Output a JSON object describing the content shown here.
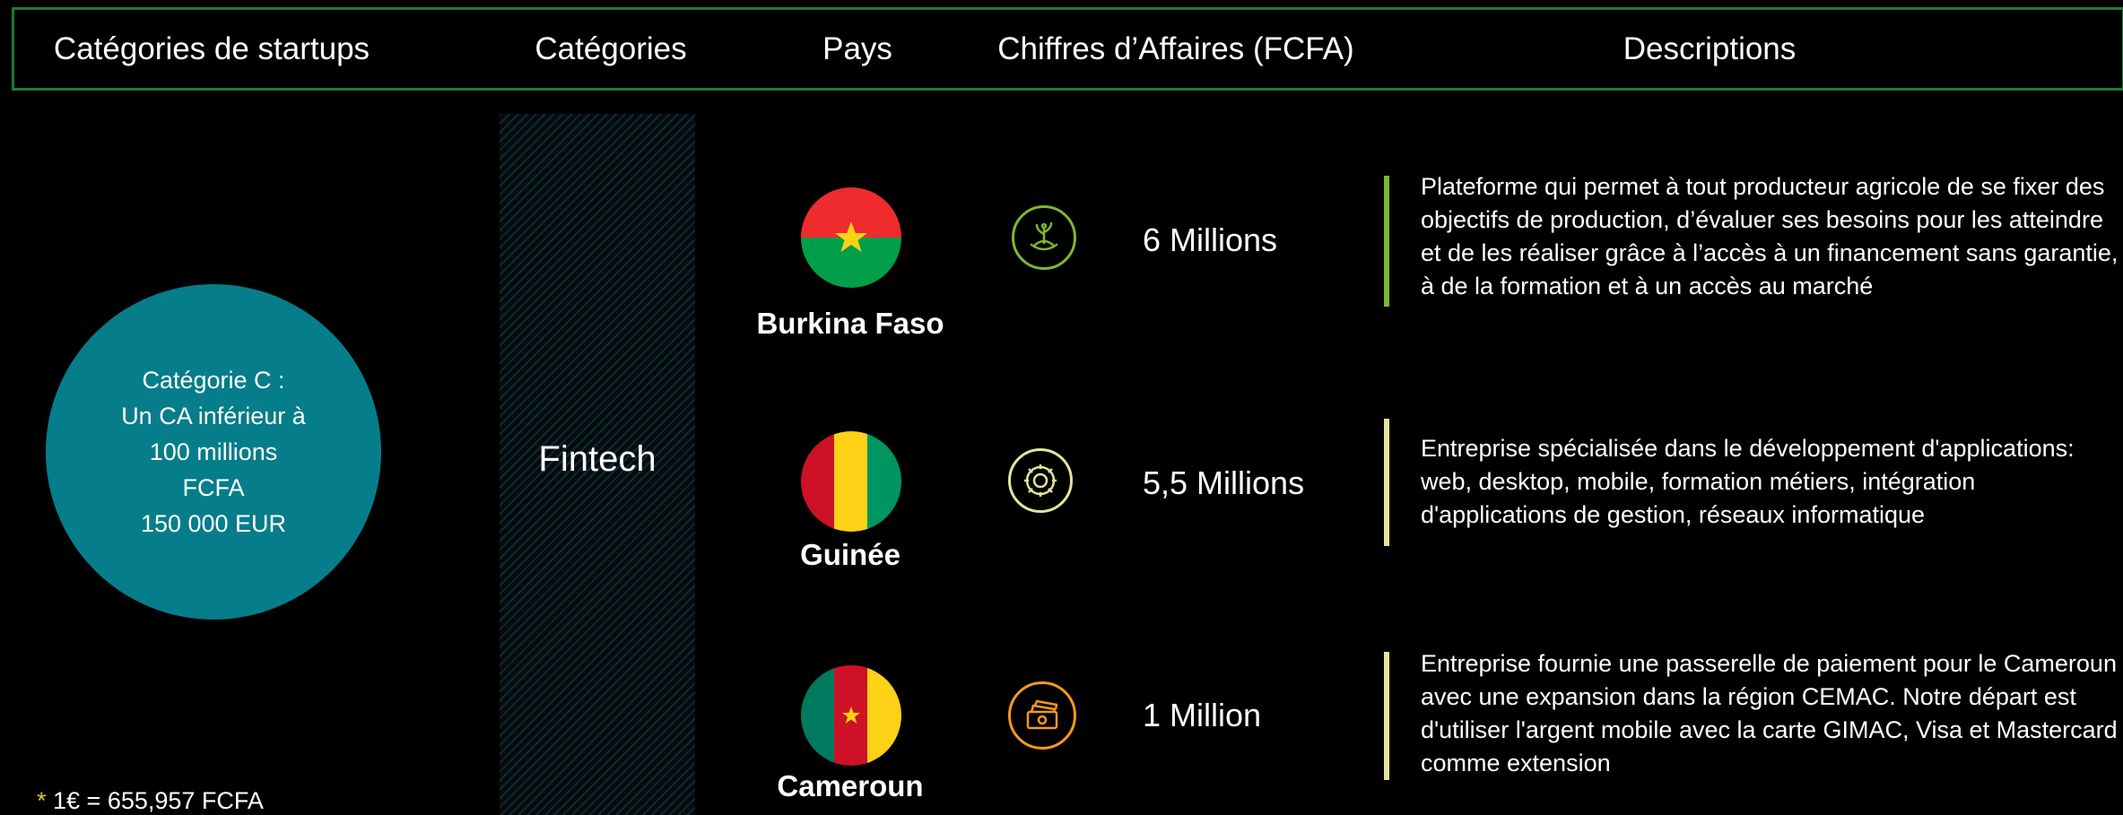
{
  "header": {
    "col1": "Catégories de startups",
    "col2": "Catégories",
    "col3": "Pays",
    "col4": "Chiffres d’Affaires (FCFA)",
    "col5": "Descriptions"
  },
  "category_circle": {
    "line1": "Catégorie C :",
    "line2": "Un CA inférieur à",
    "line3": "100 millions",
    "line4": "FCFA",
    "line5": "150 000 EUR"
  },
  "sector": "Fintech",
  "footnote": {
    "star": "*",
    "text": " 1€ = 655,957 FCFA"
  },
  "colors": {
    "header_border": "#1f7a35",
    "circle": "#067d8a",
    "bar_green": "#7cb82f",
    "bar_yellow": "#e5e49a",
    "icon_orange": "#f39a1c"
  },
  "rows": [
    {
      "country": "Burkina Faso",
      "flag": "burkina-faso-flag",
      "icon": "agriculture-plant-icon",
      "amount": "6 Millions",
      "description": "Plateforme qui permet à tout producteur agricole de se fixer des objectifs de production, d’évaluer ses besoins pour les atteindre et de les réaliser grâce à l’accès à un financement sans garantie, à de la formation et à un accès au marché"
    },
    {
      "country": "Guinée",
      "flag": "guinea-flag",
      "icon": "software-gear-icon",
      "amount": "5,5 Millions",
      "description": "Entreprise spécialisée dans le développement d'applications: web, desktop, mobile, formation métiers, intégration d'applications de gestion, réseaux informatique"
    },
    {
      "country": "Cameroun",
      "flag": "cameroon-flag",
      "icon": "money-payment-icon",
      "amount": "1 Million",
      "description": "Entreprise fournie une passerelle de paiement pour le Cameroun avec une expansion dans la région CEMAC. Notre départ est d'utiliser l'argent mobile avec la carte GIMAC, Visa et Mastercard comme extension"
    }
  ]
}
